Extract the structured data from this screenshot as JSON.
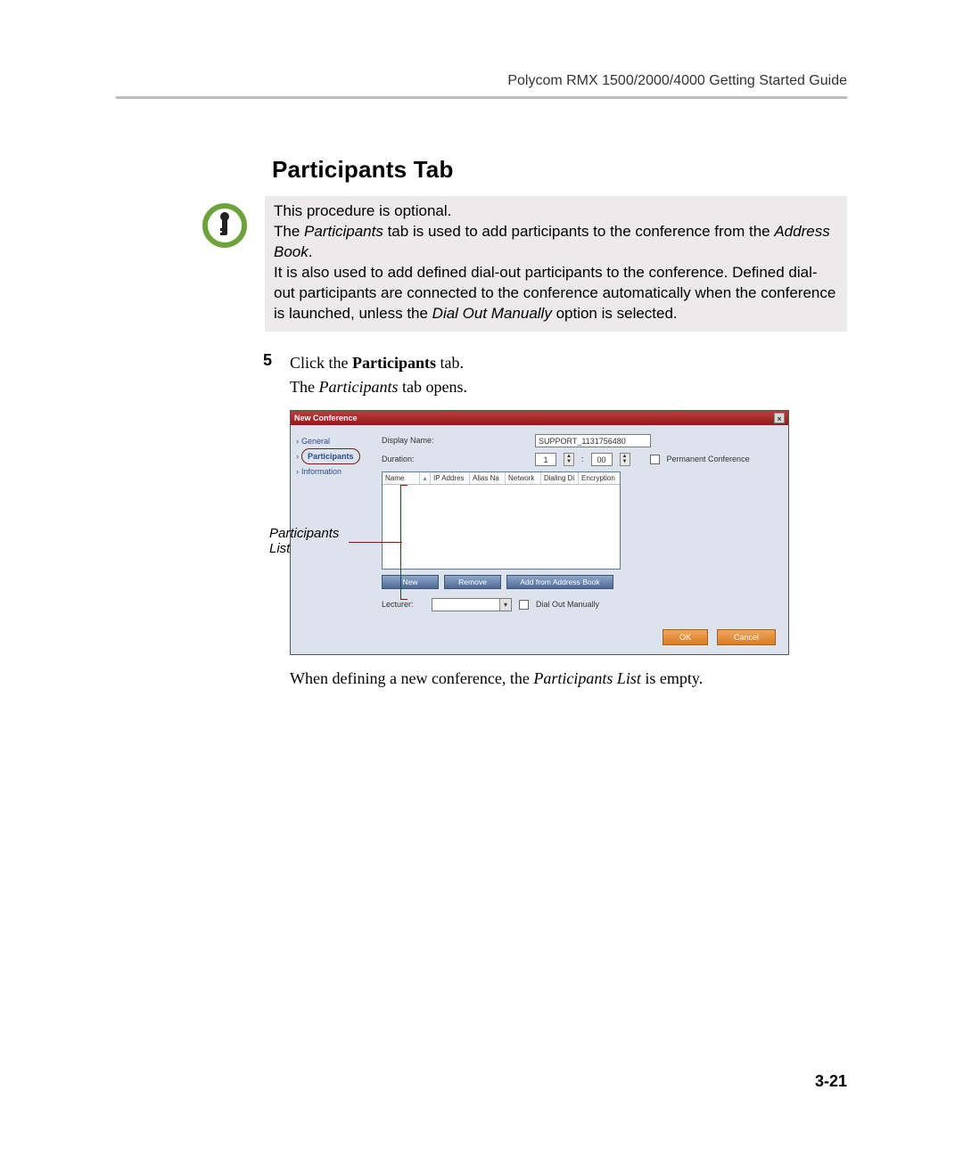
{
  "header": {
    "guide_title": "Polycom RMX 1500/2000/4000 Getting Started Guide"
  },
  "section": {
    "title": "Participants Tab"
  },
  "note": {
    "line1": "This procedure is optional.",
    "line2_pre": "The ",
    "line2_i": "Participants",
    "line2_post": " tab is used to add participants to the conference from the ",
    "line2_i2": "Address Book",
    "line2_end": ".",
    "line3_pre": "It is also used to add defined dial-out participants to the conference. Defined dial-out participants are connected to the conference automatically when the conference is launched, unless the ",
    "line3_i": "Dial Out Manually",
    "line3_post": " option is selected."
  },
  "step": {
    "num": "5",
    "l1_pre": "Click the ",
    "l1_b": "Participants",
    "l1_post": " tab.",
    "l2_pre": "The ",
    "l2_i": "Participants",
    "l2_post": " tab opens."
  },
  "dialog": {
    "title": "New Conference",
    "side": {
      "general": "General",
      "participants": "Participants",
      "information": "Information"
    },
    "fields": {
      "display_name_label": "Display Name:",
      "display_name_value": "SUPPORT_1131756480",
      "duration_label": "Duration:",
      "duration_h": "1",
      "duration_sep": ":",
      "duration_m": "00",
      "perm_conf": "Permanent Conference",
      "lecturer_label": "Lecturer:",
      "dial_out": "Dial Out Manually"
    },
    "table_cols": [
      "Name",
      "IP Addres",
      "Alias Na",
      "Network",
      "Dialing Di",
      "Encryption"
    ],
    "buttons": {
      "new": "New",
      "remove": "Remove",
      "add_ab": "Add from Address Book"
    },
    "footer": {
      "ok": "OK",
      "cancel": "Cancel"
    }
  },
  "annotation": {
    "label": "Participants List"
  },
  "after": {
    "pre": "When defining a new conference, the ",
    "i": "Participants List",
    "post": " is empty."
  },
  "page_number": "3-21"
}
